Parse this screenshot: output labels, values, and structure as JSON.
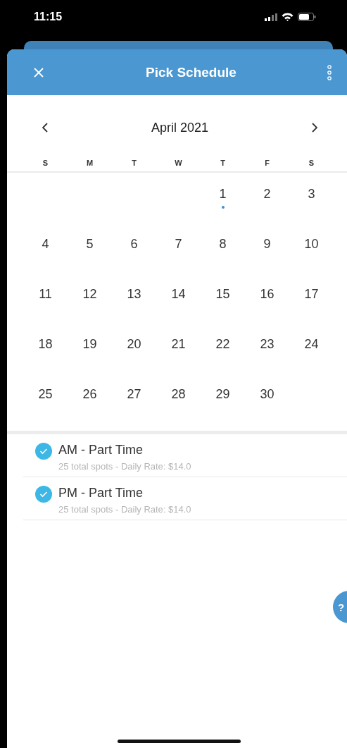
{
  "status_bar": {
    "time": "11:15"
  },
  "header": {
    "title": "Pick Schedule"
  },
  "calendar": {
    "month": "April 2021",
    "weekdays": [
      "S",
      "M",
      "T",
      "W",
      "T",
      "F",
      "S"
    ],
    "weeks": [
      [
        {
          "day": "1",
          "marked": true
        },
        {
          "day": "2",
          "marked": false
        },
        {
          "day": "3",
          "marked": false
        }
      ],
      [
        {
          "day": "4",
          "marked": false
        },
        {
          "day": "5",
          "marked": false
        },
        {
          "day": "6",
          "marked": false
        },
        {
          "day": "7",
          "marked": false
        },
        {
          "day": "8",
          "marked": false
        },
        {
          "day": "9",
          "marked": false
        },
        {
          "day": "10",
          "marked": false
        }
      ],
      [
        {
          "day": "11",
          "marked": false
        },
        {
          "day": "12",
          "marked": false
        },
        {
          "day": "13",
          "marked": false
        },
        {
          "day": "14",
          "marked": false
        },
        {
          "day": "15",
          "marked": false
        },
        {
          "day": "16",
          "marked": false
        },
        {
          "day": "17",
          "marked": false
        }
      ],
      [
        {
          "day": "18",
          "marked": false
        },
        {
          "day": "19",
          "marked": false
        },
        {
          "day": "20",
          "marked": false
        },
        {
          "day": "21",
          "marked": false
        },
        {
          "day": "22",
          "marked": false
        },
        {
          "day": "23",
          "marked": false
        },
        {
          "day": "24",
          "marked": false
        }
      ],
      [
        {
          "day": "25",
          "marked": false
        },
        {
          "day": "26",
          "marked": false
        },
        {
          "day": "27",
          "marked": false
        },
        {
          "day": "28",
          "marked": false
        },
        {
          "day": "29",
          "marked": false
        },
        {
          "day": "30",
          "marked": false
        }
      ]
    ]
  },
  "schedules": [
    {
      "title": "AM - Part Time",
      "details": "25 total spots - Daily Rate: $14.0",
      "checked": true
    },
    {
      "title": "PM - Part Time",
      "details": "25 total spots - Daily Rate: $14.0",
      "checked": true
    }
  ],
  "help": {
    "label": "?"
  }
}
